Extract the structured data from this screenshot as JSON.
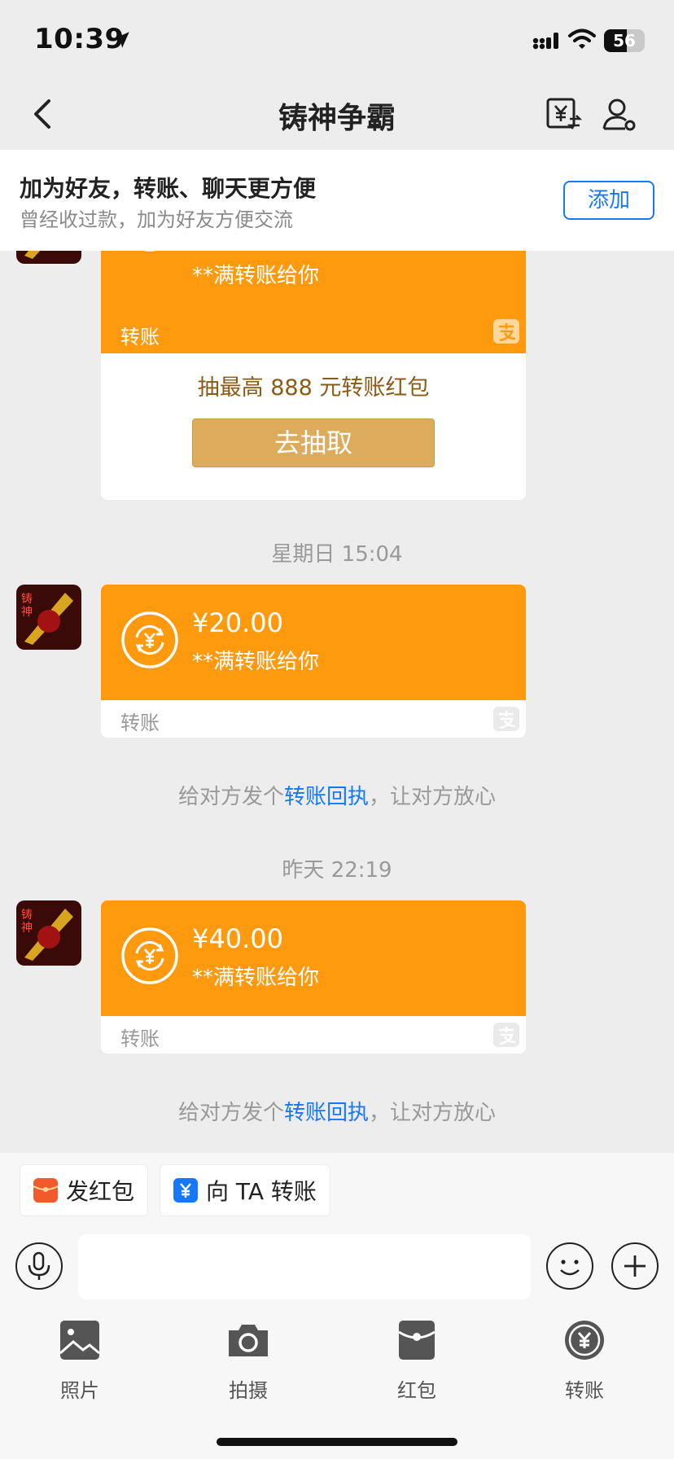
{
  "status_bar": {
    "time": "10:39",
    "battery": "56",
    "battery_level": 0.56
  },
  "nav": {
    "title": "铸神争霸"
  },
  "banner": {
    "title": "加为好友，转账、聊天更方便",
    "subtitle": "曾经收过款，加为好友方便交流",
    "add_label": "添加"
  },
  "top_card": {
    "desc": "**满转账给你",
    "type_label": "转账",
    "promo": "抽最高 888 元转账红包",
    "draw_label": "去抽取"
  },
  "messages": [
    {
      "timestamp": "星期日 15:04",
      "amount": "¥20.00",
      "desc": "**满转账给你",
      "type_label": "转账"
    },
    {
      "timestamp": "昨天 22:19",
      "amount": "¥40.00",
      "desc": "**满转账给你",
      "type_label": "转账"
    }
  ],
  "receipt_tip": {
    "before": "给对方发个",
    "link": "转账回执",
    "after": "，让对方放心"
  },
  "quick_actions": {
    "red_packet": "发红包",
    "transfer_to": "向 TA 转账"
  },
  "tools": {
    "photo": "照片",
    "camera": "拍摄",
    "red_packet": "红包",
    "transfer": "转账"
  },
  "colors": {
    "orange": "#ff9a0f",
    "blue": "#1677ff",
    "gold_button": "#dcab5c",
    "promo_text": "#8b5a16"
  }
}
